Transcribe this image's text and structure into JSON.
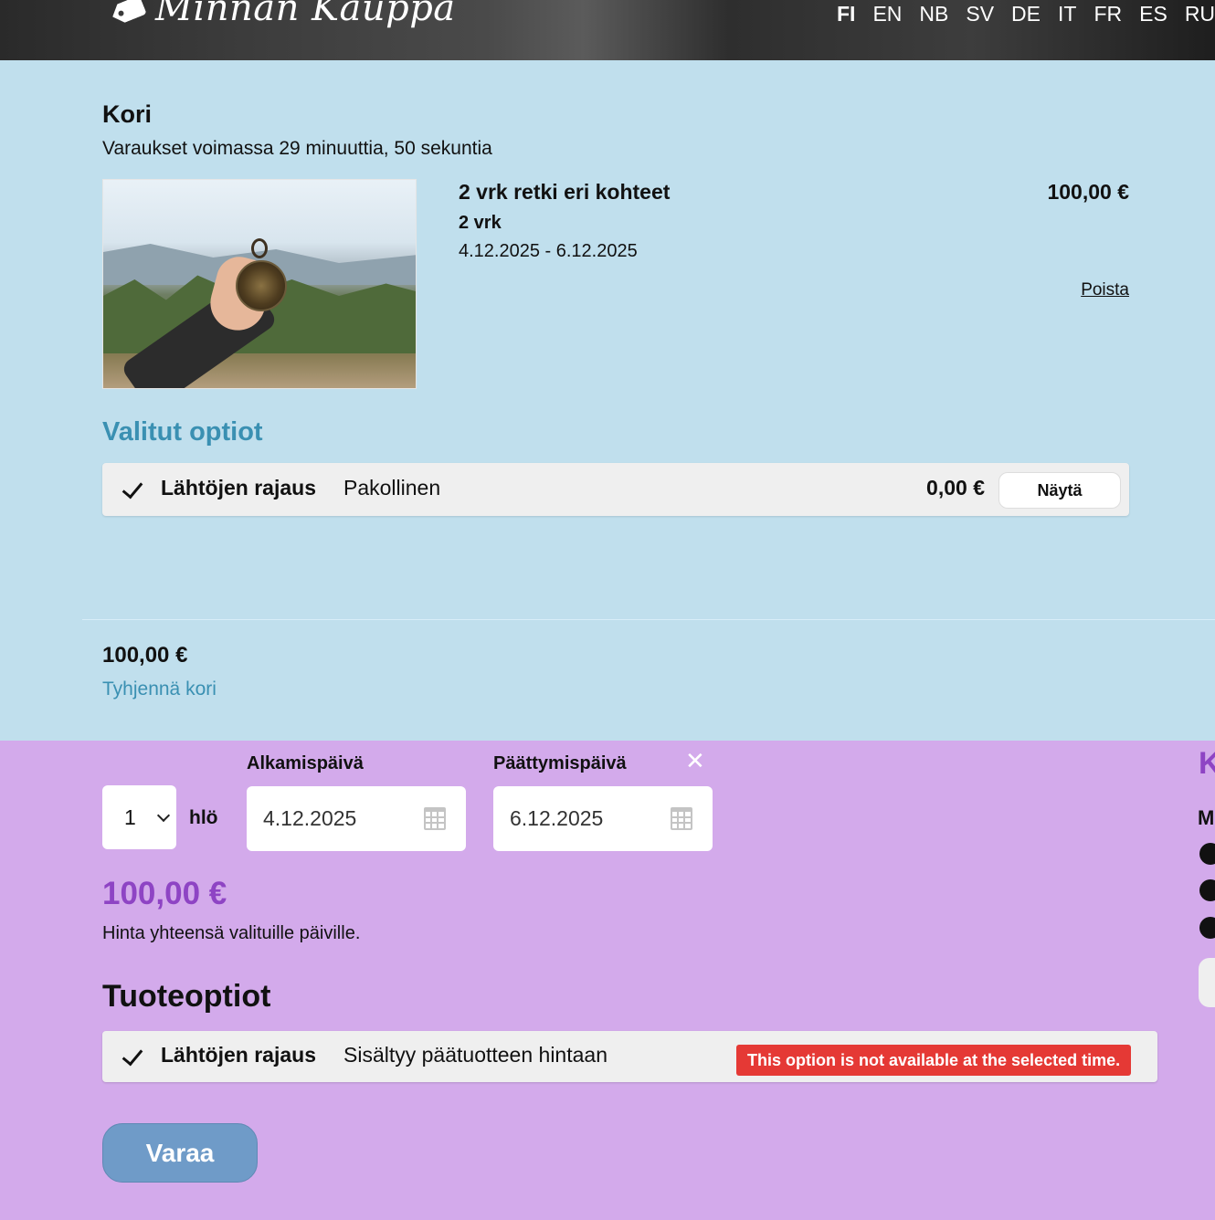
{
  "header": {
    "logo_text": "Minnan Kauppa",
    "languages": [
      "FI",
      "EN",
      "NB",
      "SV",
      "DE",
      "IT",
      "FR",
      "ES",
      "RU"
    ],
    "active_language": "FI"
  },
  "cart": {
    "title": "Kori",
    "timer_text": "Varaukset voimassa 29 minuuttia, 50 sekuntia",
    "item": {
      "title": "2 vrk retki eri kohteet",
      "duration": "2 vrk",
      "dates": "4.12.2025 - 6.12.2025",
      "price": "100,00 €",
      "remove_label": "Poista"
    },
    "selected_options_title": "Valitut optiot",
    "selected_option": {
      "name": "Lähtöjen rajaus",
      "description": "Pakollinen",
      "price": "0,00 €",
      "show_label": "Näytä"
    },
    "total": "100,00 €",
    "clear_label": "Tyhjennä kori"
  },
  "booking": {
    "quantity": "1",
    "quantity_unit": "hlö",
    "start_label": "Alkamispäivä",
    "start_value": "4.12.2025",
    "end_label": "Päättymispäivä",
    "end_value": "6.12.2025",
    "clear_symbol": "✕",
    "price": "100,00 €",
    "price_note": "Hinta yhteensä valituille päiville.",
    "options_title": "Tuoteoptiot",
    "product_option": {
      "name": "Lähtöjen rajaus",
      "description": "Sisältyy päätuotteen hintaan",
      "warning": "This option is not available at the selected time."
    },
    "book_label": "Varaa"
  },
  "sidebar": {
    "heading_fragment": "K",
    "subheading_fragment": "M"
  },
  "colors": {
    "cart_bg": "#c0dfed",
    "booking_bg": "#d3aaeb",
    "accent_blue": "#3a90b2",
    "accent_purple": "#8e44c4",
    "warning_red": "#e53935",
    "button_blue": "#6f9bc8"
  },
  "icons": [
    "tag-icon",
    "check-icon",
    "chevron-down-icon",
    "calendar-icon",
    "close-icon",
    "email-icon",
    "phone-icon",
    "contact-icon"
  ]
}
